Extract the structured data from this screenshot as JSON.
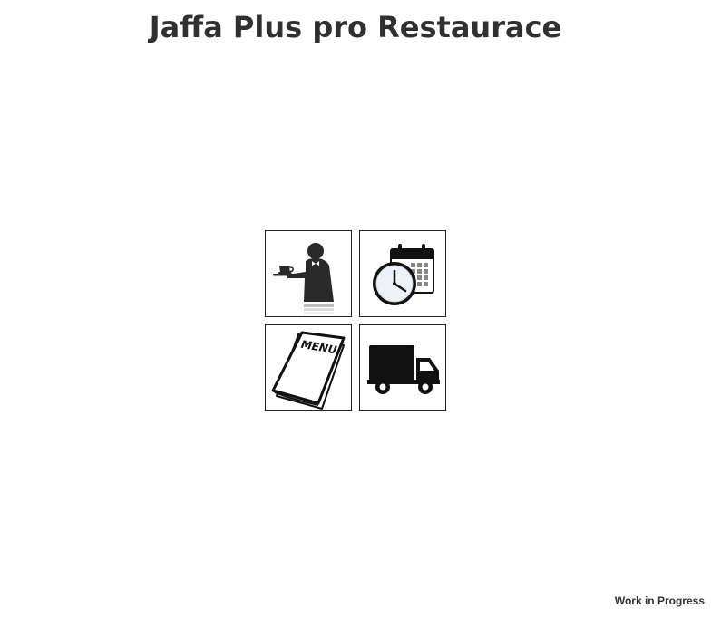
{
  "header": {
    "title": "Jaffa Plus pro Restaurace"
  },
  "tiles": [
    {
      "icon": "waiter-icon"
    },
    {
      "icon": "calendar-clock-icon"
    },
    {
      "icon": "menu-icon"
    },
    {
      "icon": "delivery-truck-icon"
    }
  ],
  "tiles_menu_text": "MENU",
  "footer": {
    "status": "Work in Progress"
  }
}
